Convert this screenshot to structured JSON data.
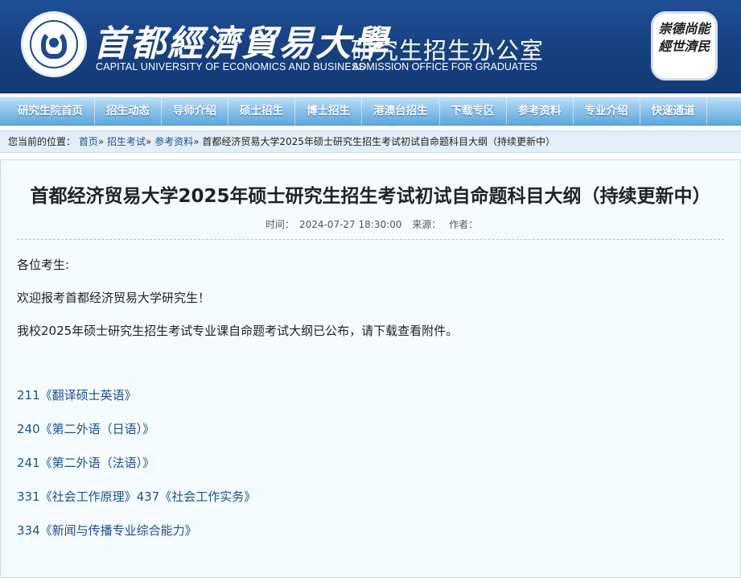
{
  "header": {
    "school_cn": "首都經濟貿易大學",
    "school_en": "CAPITAL UNIVERSITY OF ECONOMICS AND BUSINESS",
    "office_cn": "研究生招生办公室",
    "office_en": "ADMISSION OFFICE FOR GRADUATES",
    "motto": "崇德尚能經世濟民"
  },
  "nav": {
    "items": [
      "研究生院首页",
      "招生动态",
      "导师介绍",
      "硕士招生",
      "博士招生",
      "港澳台招生",
      "下载专区",
      "参考资料",
      "专业介绍",
      "快速通道"
    ]
  },
  "breadcrumb": {
    "prefix": "您当前的位置：",
    "links": [
      "首页",
      "招生考试",
      "参考资料"
    ],
    "separator": "»",
    "current": "首都经济贸易大学2025年硕士研究生招生考试初试自命题科目大纲（持续更新中）"
  },
  "article": {
    "title": "首都经济贸易大学2025年硕士研究生招生考试初试自命题科目大纲（持续更新中）",
    "meta": {
      "time_label": "时间：",
      "time_value": "2024-07-27 18:30:00",
      "source_label": "来源：",
      "author_label": "作者："
    },
    "paragraphs": [
      "各位考生:",
      "欢迎报考首都经济贸易大学研究生！",
      "我校2025年硕士研究生招生考试专业课自命题考试大纲已公布，请下载查看附件。"
    ],
    "links": [
      [
        "211《翻译硕士英语》"
      ],
      [
        "240《第二外语（日语）》"
      ],
      [
        "241《第二外语（法语）》"
      ],
      [
        "331《社会工作原理》",
        "437《社会工作实务》"
      ],
      [
        "334《新闻与传播专业综合能力》"
      ]
    ]
  }
}
